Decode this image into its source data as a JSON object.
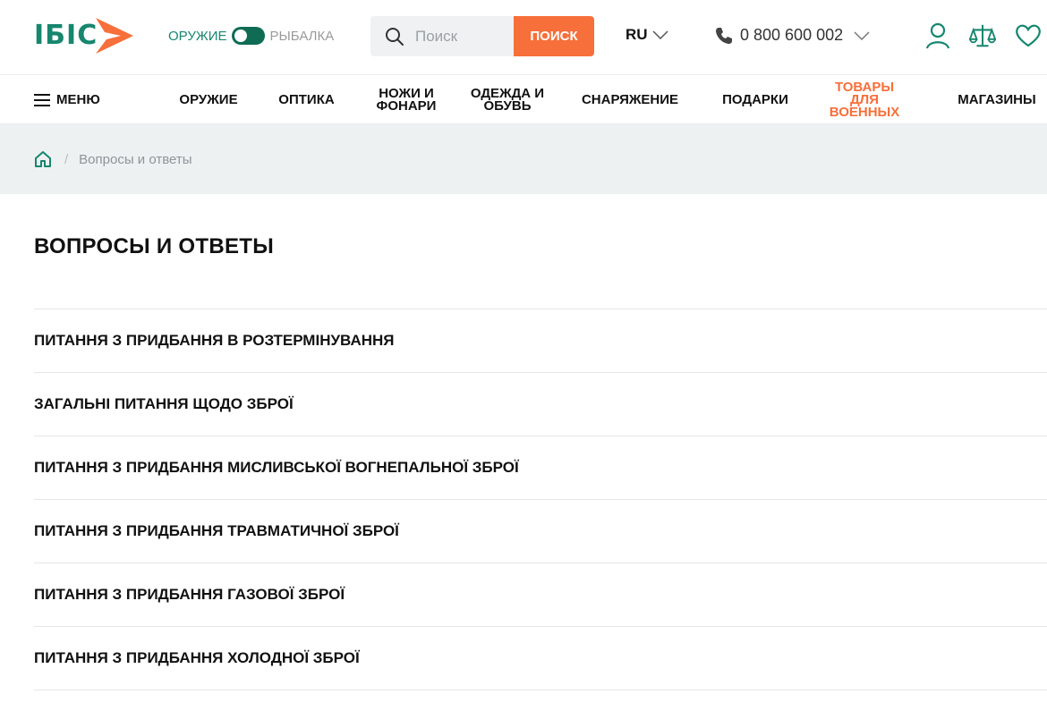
{
  "brand": {
    "logo_text": "ІБІС",
    "colors": {
      "green": "#17866f",
      "orange": "#f76f3a",
      "dark_green": "#0f6b54"
    }
  },
  "header": {
    "toggle": {
      "left_label": "ОРУЖИЕ",
      "right_label": "РЫБАЛКА",
      "state": "left-active"
    },
    "search": {
      "placeholder": "Поиск",
      "button_label": "ПОИСК",
      "icon": "search-icon"
    },
    "language": {
      "value": "RU",
      "icon": "chevron-down-icon"
    },
    "phone": {
      "number": "0 800 600 002",
      "icon": "phone-icon"
    },
    "icons": [
      "user-icon",
      "scales-icon",
      "heart-icon"
    ]
  },
  "nav": {
    "menu_label": "МЕНЮ",
    "items": [
      {
        "label": "ОРУЖИЕ"
      },
      {
        "label": "ОПТИКА"
      },
      {
        "label": "НОЖИ И ФОНАРИ"
      },
      {
        "label": "ОДЕЖДА И ОБУВЬ"
      },
      {
        "label": "СНАРЯЖЕНИЕ"
      },
      {
        "label": "ПОДАРКИ"
      },
      {
        "label": "ТОВАРЫ ДЛЯ ВОЕННЫХ",
        "highlight": true
      },
      {
        "label": "МАГАЗИНЫ"
      }
    ]
  },
  "breadcrumb": {
    "home_icon": "home-icon",
    "separator": "/",
    "current": "Вопросы и ответы"
  },
  "main": {
    "title": "ВОПРОСЫ И ОТВЕТЫ",
    "faq_items": [
      "ПИТАННЯ З ПРИДБАННЯ В РОЗТЕРМІНУВАННЯ",
      "ЗАГАЛЬНІ ПИТАННЯ ЩОДО ЗБРОЇ",
      "ПИТАННЯ З ПРИДБАННЯ МИСЛИВСЬКОЇ ВОГНЕПАЛЬНОЇ ЗБРОЇ",
      "ПИТАННЯ З ПРИДБАННЯ ТРАВМАТИЧНОЇ ЗБРОЇ",
      "ПИТАННЯ З ПРИДБАННЯ ГАЗОВОЇ ЗБРОЇ",
      "ПИТАННЯ З ПРИДБАННЯ ХОЛОДНОЇ ЗБРОЇ"
    ]
  }
}
